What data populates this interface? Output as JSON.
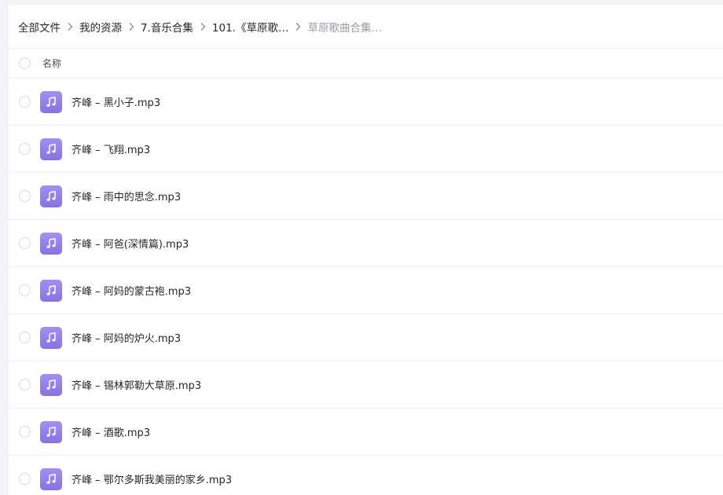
{
  "breadcrumb": {
    "items": [
      "全部文件",
      "我的资源",
      "7.音乐合集",
      "101.《草原歌…",
      "草原歌曲合集…"
    ]
  },
  "table": {
    "column_name": "名称"
  },
  "files": [
    {
      "name": "齐峰 – 黑小子.mp3",
      "icon": "music-note-icon"
    },
    {
      "name": "齐峰 – 飞翔.mp3",
      "icon": "music-note-icon"
    },
    {
      "name": "齐峰 – 雨中的思念.mp3",
      "icon": "music-note-icon"
    },
    {
      "name": "齐峰 – 阿爸(深情篇).mp3",
      "icon": "music-note-icon"
    },
    {
      "name": "齐峰 – 阿妈的蒙古袍.mp3",
      "icon": "music-note-icon"
    },
    {
      "name": "齐峰 – 阿妈的炉火.mp3",
      "icon": "music-note-icon"
    },
    {
      "name": "齐峰 – 锡林郭勒大草原.mp3",
      "icon": "music-note-icon"
    },
    {
      "name": "齐峰 – 酒歌.mp3",
      "icon": "music-note-icon"
    },
    {
      "name": "齐峰 – 鄂尔多斯我美丽的家乡.mp3",
      "icon": "music-note-icon"
    }
  ],
  "colors": {
    "icon_gradient_top": "#a190f3",
    "icon_gradient_bottom": "#8672e6",
    "muted_text": "#9a9ba0"
  }
}
